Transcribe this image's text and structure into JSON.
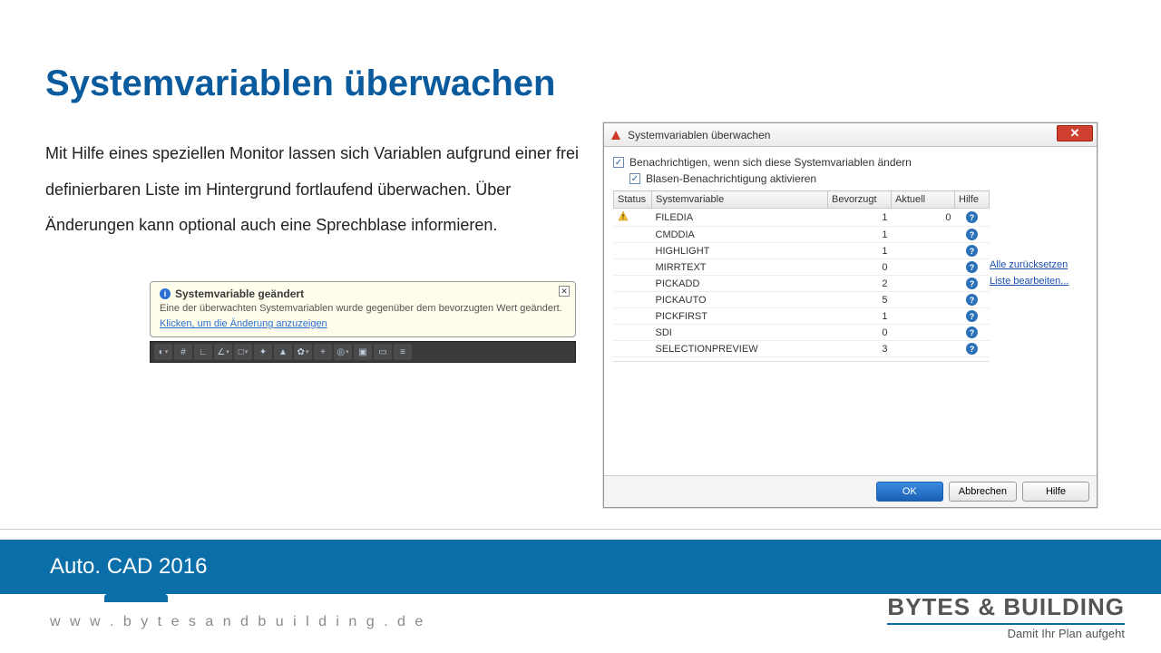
{
  "title": "Systemvariablen überwachen",
  "body_text": "Mit Hilfe eines speziellen Monitor lassen sich Variablen aufgrund einer frei definierbaren Liste im Hintergrund fortlaufend überwachen. Über Änderungen kann optional auch eine Sprechblase informieren.",
  "balloon": {
    "title": "Systemvariable geändert",
    "body": "Eine der überwachten Systemvariablen wurde gegenüber dem bevorzugten Wert geändert.",
    "link": "Klicken, um die Änderung anzuzeigen"
  },
  "dialog": {
    "title": "Systemvariablen überwachen",
    "checkbox1": "Benachrichtigen, wenn sich diese Systemvariablen ändern",
    "checkbox2": "Blasen-Benachrichtigung aktivieren",
    "columns": {
      "status": "Status",
      "sysvar": "Systemvariable",
      "preferred": "Bevorzugt",
      "current": "Aktuell",
      "help": "Hilfe"
    },
    "rows": [
      {
        "warn": true,
        "name": "FILEDIA",
        "pref": "1",
        "cur": "0"
      },
      {
        "warn": false,
        "name": "CMDDIA",
        "pref": "1",
        "cur": ""
      },
      {
        "warn": false,
        "name": "HIGHLIGHT",
        "pref": "1",
        "cur": ""
      },
      {
        "warn": false,
        "name": "MIRRTEXT",
        "pref": "0",
        "cur": ""
      },
      {
        "warn": false,
        "name": "PICKADD",
        "pref": "2",
        "cur": ""
      },
      {
        "warn": false,
        "name": "PICKAUTO",
        "pref": "5",
        "cur": ""
      },
      {
        "warn": false,
        "name": "PICKFIRST",
        "pref": "1",
        "cur": ""
      },
      {
        "warn": false,
        "name": "SDI",
        "pref": "0",
        "cur": ""
      },
      {
        "warn": false,
        "name": "SELECTIONPREVIEW",
        "pref": "3",
        "cur": ""
      }
    ],
    "actions": {
      "reset_all": "Alle zurücksetzen",
      "edit_list": "Liste bearbeiten..."
    },
    "buttons": {
      "ok": "OK",
      "cancel": "Abbrechen",
      "help": "Hilfe"
    }
  },
  "footer": {
    "product": "Auto. CAD 2016",
    "website": "w w w . b y t e s a n d b u i l d i n g . d e",
    "brand_name": "BYTES & BUILDING",
    "brand_tagline": "Damit Ihr Plan aufgeht"
  }
}
